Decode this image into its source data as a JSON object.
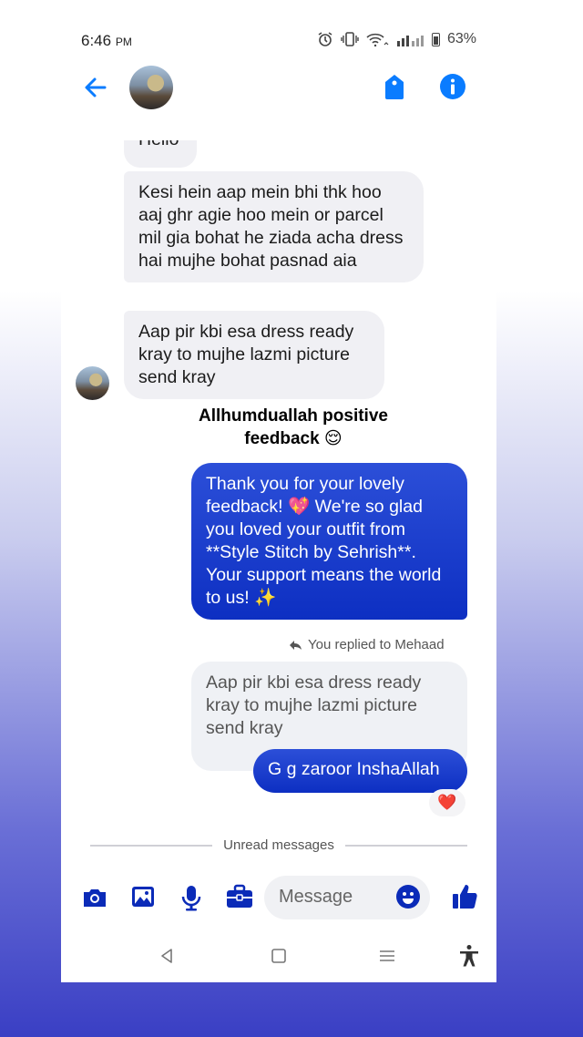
{
  "status_bar": {
    "time": "6:46",
    "ampm": "PM",
    "battery": "63%"
  },
  "header": {
    "contact_name": ""
  },
  "messages": {
    "hello_partial": "Hello",
    "in_1": "Kesi hein aap mein bhi thk hoo aaj ghr agie hoo mein or parcel mil gia bohat he ziada acha dress hai mujhe bohat pasnad aia",
    "in_2": "Aap pir kbi esa dress ready kray to mujhe lazmi picture send kray",
    "caption_line1": "Allhumduallah positive",
    "caption_line2": "feedback 😌",
    "out_1": "Thank you for your lovely feedback! 💖 We're so glad you loved your outfit from **Style Stitch by Sehrish**. Your support means the world to us! ✨",
    "replied_note": "You replied to Mehaad",
    "quoted": "Aap pir kbi esa dress ready kray to mujhe lazmi picture send kray",
    "out_2": "G g zaroor InshaAllah",
    "reaction": "❤️",
    "unread_divider": "Unread messages"
  },
  "composer": {
    "placeholder": "Message"
  },
  "colors": {
    "accent": "#0a7cff",
    "outgoing": "#0d2fc2",
    "dark_blue_icon": "#0b2bb8"
  },
  "icons": [
    "back-arrow-icon",
    "tag-icon",
    "info-icon",
    "camera-icon",
    "gallery-icon",
    "microphone-icon",
    "briefcase-icon",
    "emoji-icon",
    "thumbs-up-icon",
    "nav-back-icon",
    "nav-home-icon",
    "nav-recents-icon",
    "accessibility-icon"
  ]
}
